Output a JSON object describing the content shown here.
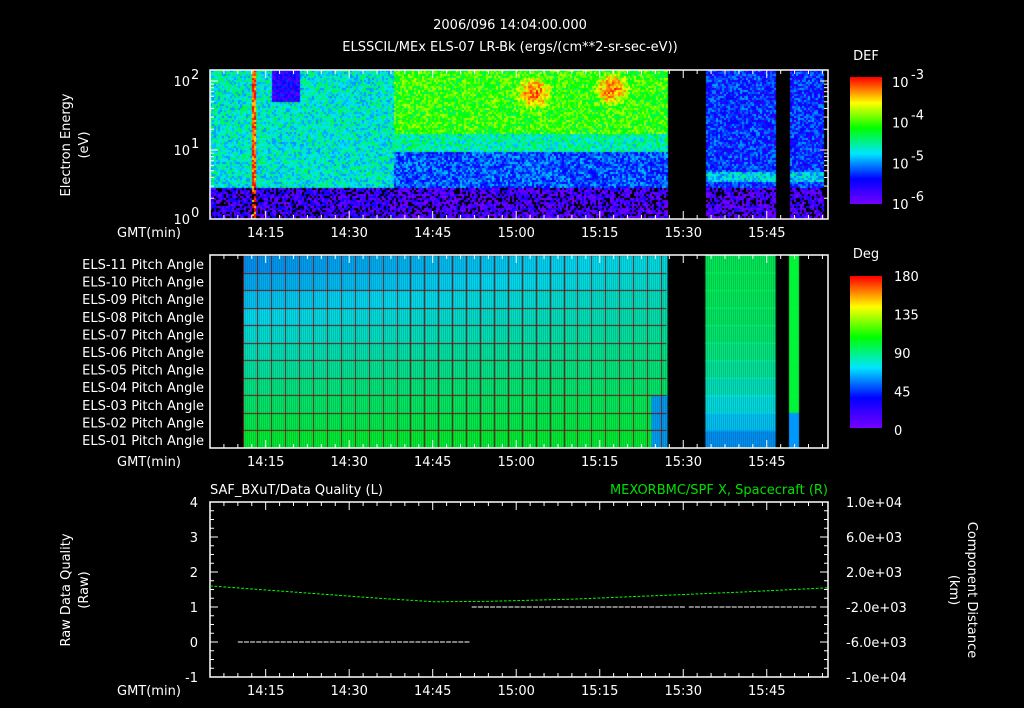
{
  "header": {
    "date_time": "2006/096 14:04:00.000",
    "title": "ELSSCIL/MEx ELS-07 LR-Bk  (ergs/(cm**2-sr-sec-eV))"
  },
  "time_axis": {
    "label": "GMT(min)",
    "ticks": [
      "14:15",
      "14:30",
      "14:45",
      "15:00",
      "15:15",
      "15:30",
      "15:45"
    ],
    "range_min_after_14": [
      5,
      116
    ]
  },
  "chart_data": [
    {
      "type": "heatmap",
      "name": "electron-spectrogram",
      "ylabel": "Electron Energy",
      "yunit": "(eV)",
      "yscale": "log",
      "ylim": [
        1,
        145
      ],
      "ytick_labels": [
        {
          "base": "10",
          "exp": "0",
          "value": 1
        },
        {
          "base": "10",
          "exp": "1",
          "value": 10
        },
        {
          "base": "10",
          "exp": "2",
          "value": 100
        }
      ],
      "colorbar": {
        "title": "DEF",
        "range_log10": [
          -6,
          -3
        ],
        "tick_labels": [
          {
            "base": "10",
            "exp": "-3"
          },
          {
            "base": "10",
            "exp": "-4"
          },
          {
            "base": "10",
            "exp": "-5"
          },
          {
            "base": "10",
            "exp": "-6"
          }
        ]
      },
      "data_gaps_min_after_14": [
        [
          87,
          94
        ],
        [
          106.5,
          109
        ]
      ],
      "data_end_min_after_14": 115,
      "features": [
        {
          "time_range": [
            5,
            38
          ],
          "energy_above_3eV_log10_def": -4.6
        },
        {
          "time_range": [
            38,
            87
          ],
          "energy_20_100eV_log10_def": -4.0
        },
        {
          "peak_time": 63,
          "energy": 70,
          "log10_def": -3.3
        },
        {
          "peak_time": 77,
          "energy": 80,
          "log10_def": -3.3
        },
        {
          "time_range": [
            94,
            115
          ],
          "log10_def": -5.2
        }
      ]
    },
    {
      "type": "heatmap",
      "name": "pitch-angle",
      "rows": [
        "ELS-11 Pitch Angle",
        "ELS-10 Pitch Angle",
        "ELS-09 Pitch Angle",
        "ELS-08 Pitch Angle",
        "ELS-07 Pitch Angle",
        "ELS-06 Pitch Angle",
        "ELS-05 Pitch Angle",
        "ELS-04 Pitch Angle",
        "ELS-03 Pitch Angle",
        "ELS-02 Pitch Angle",
        "ELS-01 Pitch Angle"
      ],
      "colorbar": {
        "title": "Deg",
        "range": [
          0,
          180
        ],
        "tick_labels": [
          "180",
          "135",
          "90",
          "45",
          "0"
        ]
      },
      "segments_min_after_14": [
        [
          11,
          87
        ],
        [
          94,
          106.5
        ],
        [
          109,
          110.5
        ]
      ],
      "first_segment_deg": {
        "top_row": 60,
        "bottom_row": 100
      },
      "second_segment_deg": {
        "top_row": 95,
        "bottom_row": 60
      }
    },
    {
      "type": "line",
      "name": "data-quality-and-position",
      "left_title": "SAF_BXuT/Data Quality (L)",
      "right_title": "MEXORBMC/SPF X, Spacecraft (R)",
      "ylabel_left": "Raw Data Quality",
      "ylabel_left_unit": "(Raw)",
      "ylabel_right": "Component Distance",
      "ylabel_right_unit": "(km)",
      "ylim_left": [
        -1,
        4
      ],
      "yticks_left": [
        "4",
        "3",
        "2",
        "1",
        "0",
        "-1"
      ],
      "ylim_right": [
        -10000,
        10000
      ],
      "yticks_right": [
        "1.0e+04",
        "6.0e+03",
        "2.0e+03",
        "-2.0e+03",
        "-6.0e+03",
        "-1.0e+04"
      ],
      "series": [
        {
          "name": "Data Quality",
          "axis": "left",
          "color": "#ffffff",
          "segments": [
            {
              "x": [
                10,
                51
              ],
              "y": 0
            },
            {
              "x": [
                52,
                89.5
              ],
              "y": 1
            },
            {
              "x": [
                91,
                113
              ],
              "y": 1
            }
          ]
        },
        {
          "name": "SPF X",
          "axis": "right",
          "color": "#00ff00",
          "x": [
            5,
            20,
            35,
            45,
            55,
            70,
            85,
            100,
            116
          ],
          "y": [
            400,
            -300,
            -1000,
            -1400,
            -1350,
            -1100,
            -700,
            -300,
            200
          ]
        }
      ]
    }
  ]
}
